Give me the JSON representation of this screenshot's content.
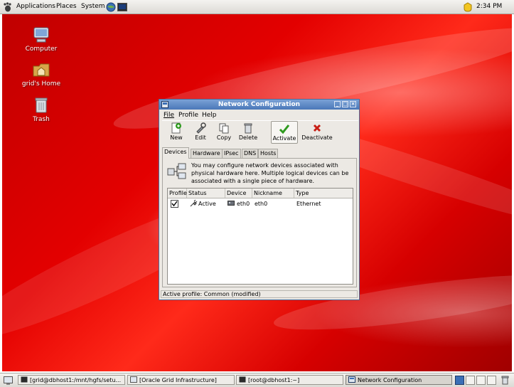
{
  "top_panel": {
    "menus": [
      "Applications",
      "Places",
      "System"
    ],
    "clock": "2:34 PM"
  },
  "desktop_icons": [
    {
      "label": "Computer",
      "icon": "computer-icon"
    },
    {
      "label": "grid's Home",
      "icon": "home-folder-icon"
    },
    {
      "label": "Trash",
      "icon": "trash-icon"
    }
  ],
  "window": {
    "title": "Network Configuration",
    "menus": [
      "File",
      "Profile",
      "Help"
    ],
    "toolbar": {
      "new": "New",
      "edit": "Edit",
      "copy": "Copy",
      "delete": "Delete",
      "activate": "Activate",
      "deactivate": "Deactivate"
    },
    "tabs": [
      "Devices",
      "Hardware",
      "IPsec",
      "DNS",
      "Hosts"
    ],
    "active_tab": "Devices",
    "info_text": "You may configure network devices associated with physical hardware here.  Multiple logical devices can be associated with a single piece of hardware.",
    "table": {
      "columns": [
        "Profile",
        "Status",
        "Device",
        "Nickname",
        "Type"
      ],
      "rows": [
        {
          "profile_checked": true,
          "status": "Active",
          "device": "eth0",
          "nickname": "eth0",
          "type": "Ethernet"
        }
      ]
    },
    "status_bar": "Active profile: Common (modified)"
  },
  "taskbar": [
    {
      "label": "[grid@dbhost1:/mnt/hgfs/setu...",
      "active": false
    },
    {
      "label": "[Oracle Grid Infrastructure]",
      "active": false
    },
    {
      "label": "[root@dbhost1:~]",
      "active": false
    },
    {
      "label": "Network Configuration",
      "active": true
    }
  ],
  "colors": {
    "desktop_red": "#e30000",
    "titlebar_blue": "#4a77b8",
    "activate_green": "#2e9a1e",
    "deactivate_red": "#c81e14"
  }
}
